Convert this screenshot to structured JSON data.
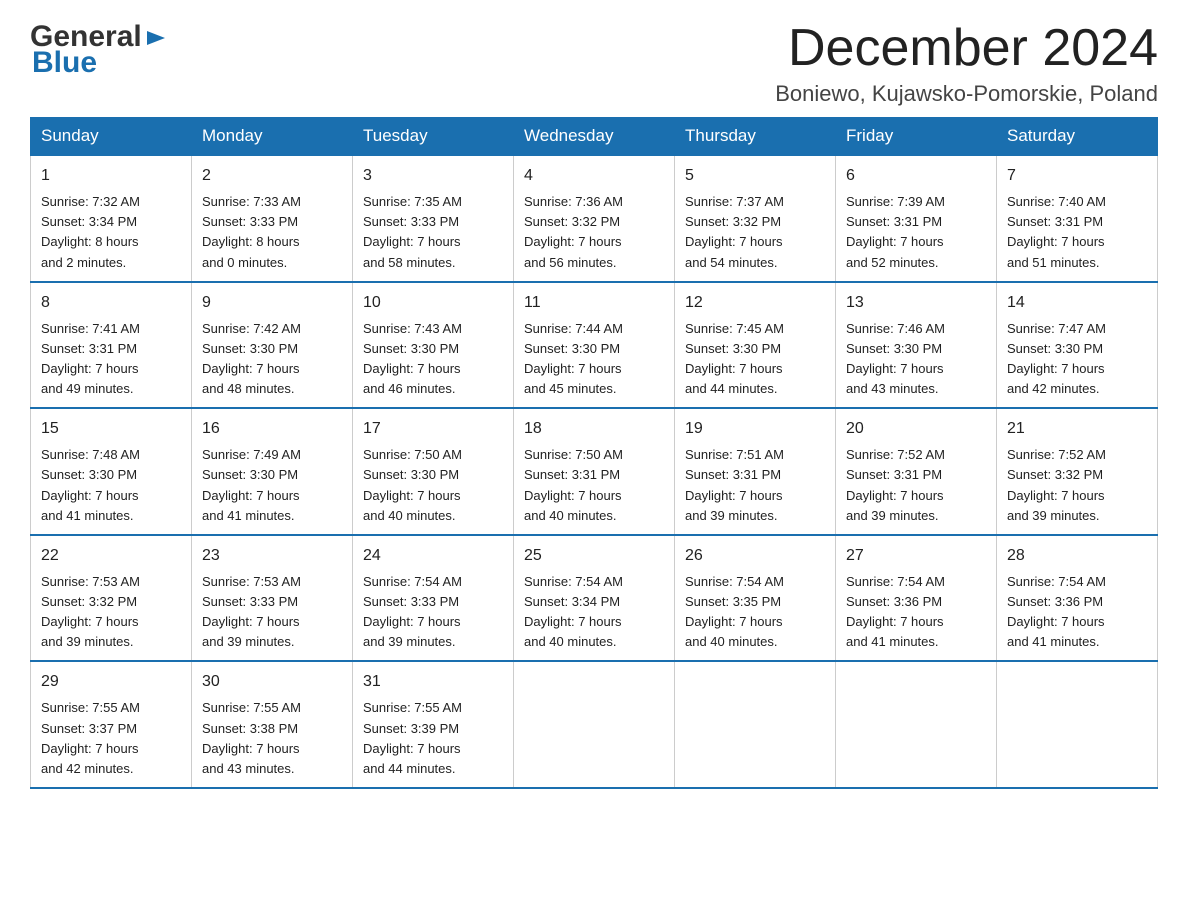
{
  "logo": {
    "general": "General",
    "blue": "Blue"
  },
  "title": "December 2024",
  "location": "Boniewo, Kujawsko-Pomorskie, Poland",
  "headers": [
    "Sunday",
    "Monday",
    "Tuesday",
    "Wednesday",
    "Thursday",
    "Friday",
    "Saturday"
  ],
  "weeks": [
    [
      {
        "day": "1",
        "sunrise": "Sunrise: 7:32 AM",
        "sunset": "Sunset: 3:34 PM",
        "daylight1": "Daylight: 8 hours",
        "daylight2": "and 2 minutes."
      },
      {
        "day": "2",
        "sunrise": "Sunrise: 7:33 AM",
        "sunset": "Sunset: 3:33 PM",
        "daylight1": "Daylight: 8 hours",
        "daylight2": "and 0 minutes."
      },
      {
        "day": "3",
        "sunrise": "Sunrise: 7:35 AM",
        "sunset": "Sunset: 3:33 PM",
        "daylight1": "Daylight: 7 hours",
        "daylight2": "and 58 minutes."
      },
      {
        "day": "4",
        "sunrise": "Sunrise: 7:36 AM",
        "sunset": "Sunset: 3:32 PM",
        "daylight1": "Daylight: 7 hours",
        "daylight2": "and 56 minutes."
      },
      {
        "day": "5",
        "sunrise": "Sunrise: 7:37 AM",
        "sunset": "Sunset: 3:32 PM",
        "daylight1": "Daylight: 7 hours",
        "daylight2": "and 54 minutes."
      },
      {
        "day": "6",
        "sunrise": "Sunrise: 7:39 AM",
        "sunset": "Sunset: 3:31 PM",
        "daylight1": "Daylight: 7 hours",
        "daylight2": "and 52 minutes."
      },
      {
        "day": "7",
        "sunrise": "Sunrise: 7:40 AM",
        "sunset": "Sunset: 3:31 PM",
        "daylight1": "Daylight: 7 hours",
        "daylight2": "and 51 minutes."
      }
    ],
    [
      {
        "day": "8",
        "sunrise": "Sunrise: 7:41 AM",
        "sunset": "Sunset: 3:31 PM",
        "daylight1": "Daylight: 7 hours",
        "daylight2": "and 49 minutes."
      },
      {
        "day": "9",
        "sunrise": "Sunrise: 7:42 AM",
        "sunset": "Sunset: 3:30 PM",
        "daylight1": "Daylight: 7 hours",
        "daylight2": "and 48 minutes."
      },
      {
        "day": "10",
        "sunrise": "Sunrise: 7:43 AM",
        "sunset": "Sunset: 3:30 PM",
        "daylight1": "Daylight: 7 hours",
        "daylight2": "and 46 minutes."
      },
      {
        "day": "11",
        "sunrise": "Sunrise: 7:44 AM",
        "sunset": "Sunset: 3:30 PM",
        "daylight1": "Daylight: 7 hours",
        "daylight2": "and 45 minutes."
      },
      {
        "day": "12",
        "sunrise": "Sunrise: 7:45 AM",
        "sunset": "Sunset: 3:30 PM",
        "daylight1": "Daylight: 7 hours",
        "daylight2": "and 44 minutes."
      },
      {
        "day": "13",
        "sunrise": "Sunrise: 7:46 AM",
        "sunset": "Sunset: 3:30 PM",
        "daylight1": "Daylight: 7 hours",
        "daylight2": "and 43 minutes."
      },
      {
        "day": "14",
        "sunrise": "Sunrise: 7:47 AM",
        "sunset": "Sunset: 3:30 PM",
        "daylight1": "Daylight: 7 hours",
        "daylight2": "and 42 minutes."
      }
    ],
    [
      {
        "day": "15",
        "sunrise": "Sunrise: 7:48 AM",
        "sunset": "Sunset: 3:30 PM",
        "daylight1": "Daylight: 7 hours",
        "daylight2": "and 41 minutes."
      },
      {
        "day": "16",
        "sunrise": "Sunrise: 7:49 AM",
        "sunset": "Sunset: 3:30 PM",
        "daylight1": "Daylight: 7 hours",
        "daylight2": "and 41 minutes."
      },
      {
        "day": "17",
        "sunrise": "Sunrise: 7:50 AM",
        "sunset": "Sunset: 3:30 PM",
        "daylight1": "Daylight: 7 hours",
        "daylight2": "and 40 minutes."
      },
      {
        "day": "18",
        "sunrise": "Sunrise: 7:50 AM",
        "sunset": "Sunset: 3:31 PM",
        "daylight1": "Daylight: 7 hours",
        "daylight2": "and 40 minutes."
      },
      {
        "day": "19",
        "sunrise": "Sunrise: 7:51 AM",
        "sunset": "Sunset: 3:31 PM",
        "daylight1": "Daylight: 7 hours",
        "daylight2": "and 39 minutes."
      },
      {
        "day": "20",
        "sunrise": "Sunrise: 7:52 AM",
        "sunset": "Sunset: 3:31 PM",
        "daylight1": "Daylight: 7 hours",
        "daylight2": "and 39 minutes."
      },
      {
        "day": "21",
        "sunrise": "Sunrise: 7:52 AM",
        "sunset": "Sunset: 3:32 PM",
        "daylight1": "Daylight: 7 hours",
        "daylight2": "and 39 minutes."
      }
    ],
    [
      {
        "day": "22",
        "sunrise": "Sunrise: 7:53 AM",
        "sunset": "Sunset: 3:32 PM",
        "daylight1": "Daylight: 7 hours",
        "daylight2": "and 39 minutes."
      },
      {
        "day": "23",
        "sunrise": "Sunrise: 7:53 AM",
        "sunset": "Sunset: 3:33 PM",
        "daylight1": "Daylight: 7 hours",
        "daylight2": "and 39 minutes."
      },
      {
        "day": "24",
        "sunrise": "Sunrise: 7:54 AM",
        "sunset": "Sunset: 3:33 PM",
        "daylight1": "Daylight: 7 hours",
        "daylight2": "and 39 minutes."
      },
      {
        "day": "25",
        "sunrise": "Sunrise: 7:54 AM",
        "sunset": "Sunset: 3:34 PM",
        "daylight1": "Daylight: 7 hours",
        "daylight2": "and 40 minutes."
      },
      {
        "day": "26",
        "sunrise": "Sunrise: 7:54 AM",
        "sunset": "Sunset: 3:35 PM",
        "daylight1": "Daylight: 7 hours",
        "daylight2": "and 40 minutes."
      },
      {
        "day": "27",
        "sunrise": "Sunrise: 7:54 AM",
        "sunset": "Sunset: 3:36 PM",
        "daylight1": "Daylight: 7 hours",
        "daylight2": "and 41 minutes."
      },
      {
        "day": "28",
        "sunrise": "Sunrise: 7:54 AM",
        "sunset": "Sunset: 3:36 PM",
        "daylight1": "Daylight: 7 hours",
        "daylight2": "and 41 minutes."
      }
    ],
    [
      {
        "day": "29",
        "sunrise": "Sunrise: 7:55 AM",
        "sunset": "Sunset: 3:37 PM",
        "daylight1": "Daylight: 7 hours",
        "daylight2": "and 42 minutes."
      },
      {
        "day": "30",
        "sunrise": "Sunrise: 7:55 AM",
        "sunset": "Sunset: 3:38 PM",
        "daylight1": "Daylight: 7 hours",
        "daylight2": "and 43 minutes."
      },
      {
        "day": "31",
        "sunrise": "Sunrise: 7:55 AM",
        "sunset": "Sunset: 3:39 PM",
        "daylight1": "Daylight: 7 hours",
        "daylight2": "and 44 minutes."
      },
      null,
      null,
      null,
      null
    ]
  ]
}
